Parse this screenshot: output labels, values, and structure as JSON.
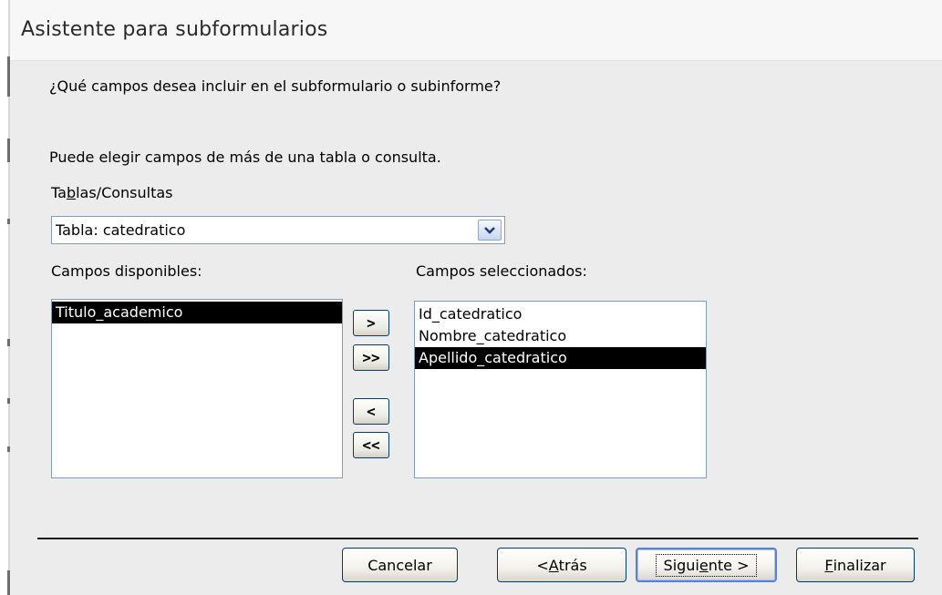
{
  "window": {
    "title": "Asistente para subformularios"
  },
  "prompt": {
    "question": "¿Qué campos desea incluir en el subformulario o subinforme?",
    "hint": "Puede elegir campos de más de una tabla o consulta."
  },
  "tables": {
    "label_pre": "Ta",
    "label_mnemonic": "b",
    "label_post": "las/Consultas",
    "selected": "Tabla: catedratico",
    "dropdown_icon": "chevron-down-icon"
  },
  "available": {
    "label": "Campos disponibles:",
    "items": [
      "Titulo_academico"
    ],
    "selected_index": 0
  },
  "selected_fields": {
    "label": "Campos seleccionados:",
    "items": [
      "Id_catedratico",
      "Nombre_catedratico",
      "Apellido_catedratico"
    ],
    "selected_index": 2
  },
  "move_buttons": {
    "add_one": ">",
    "add_all": ">>",
    "remove_one": "<",
    "remove_all": "<<"
  },
  "footer": {
    "cancel": "Cancelar",
    "back_pre": "< ",
    "back_mnemonic": "A",
    "back_post": "trás",
    "next_pre": "Sigui",
    "next_mnemonic": "e",
    "next_post": "nte >",
    "finish_mnemonic": "F",
    "finish_post": "inalizar"
  }
}
